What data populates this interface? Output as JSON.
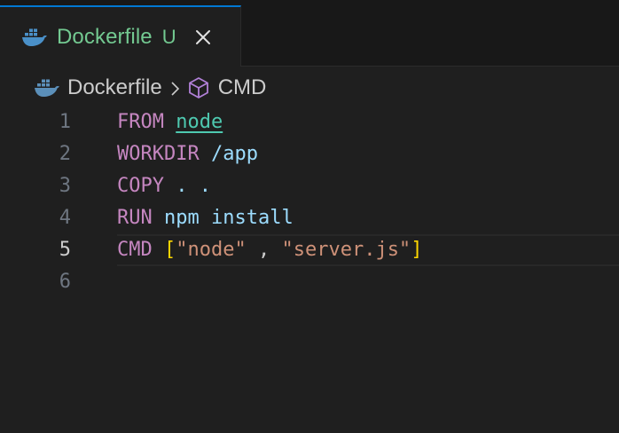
{
  "tab": {
    "icon": "docker-icon",
    "title": "Dockerfile",
    "status": "U",
    "close_icon": "close-icon",
    "accent_color": "#0078d4",
    "title_color": "#73c991"
  },
  "breadcrumb": {
    "items": [
      {
        "icon": "docker-icon",
        "label": "Dockerfile"
      },
      {
        "icon": "cube-icon",
        "label": "CMD"
      }
    ],
    "separator_icon": "chevron-right-icon"
  },
  "editor": {
    "current_line": 5,
    "lines": [
      {
        "number": "1",
        "keyword": "FROM",
        "image": "node"
      },
      {
        "number": "2",
        "keyword": "WORKDIR",
        "arg": "/app"
      },
      {
        "number": "3",
        "keyword": "COPY",
        "arg": ". ."
      },
      {
        "number": "4",
        "keyword": "RUN",
        "arg": "npm install"
      },
      {
        "number": "5",
        "keyword": "CMD",
        "open": "[",
        "str1": "\"node\"",
        "sep": " , ",
        "str2": "\"server.js\"",
        "close": "]"
      },
      {
        "number": "6"
      }
    ]
  }
}
